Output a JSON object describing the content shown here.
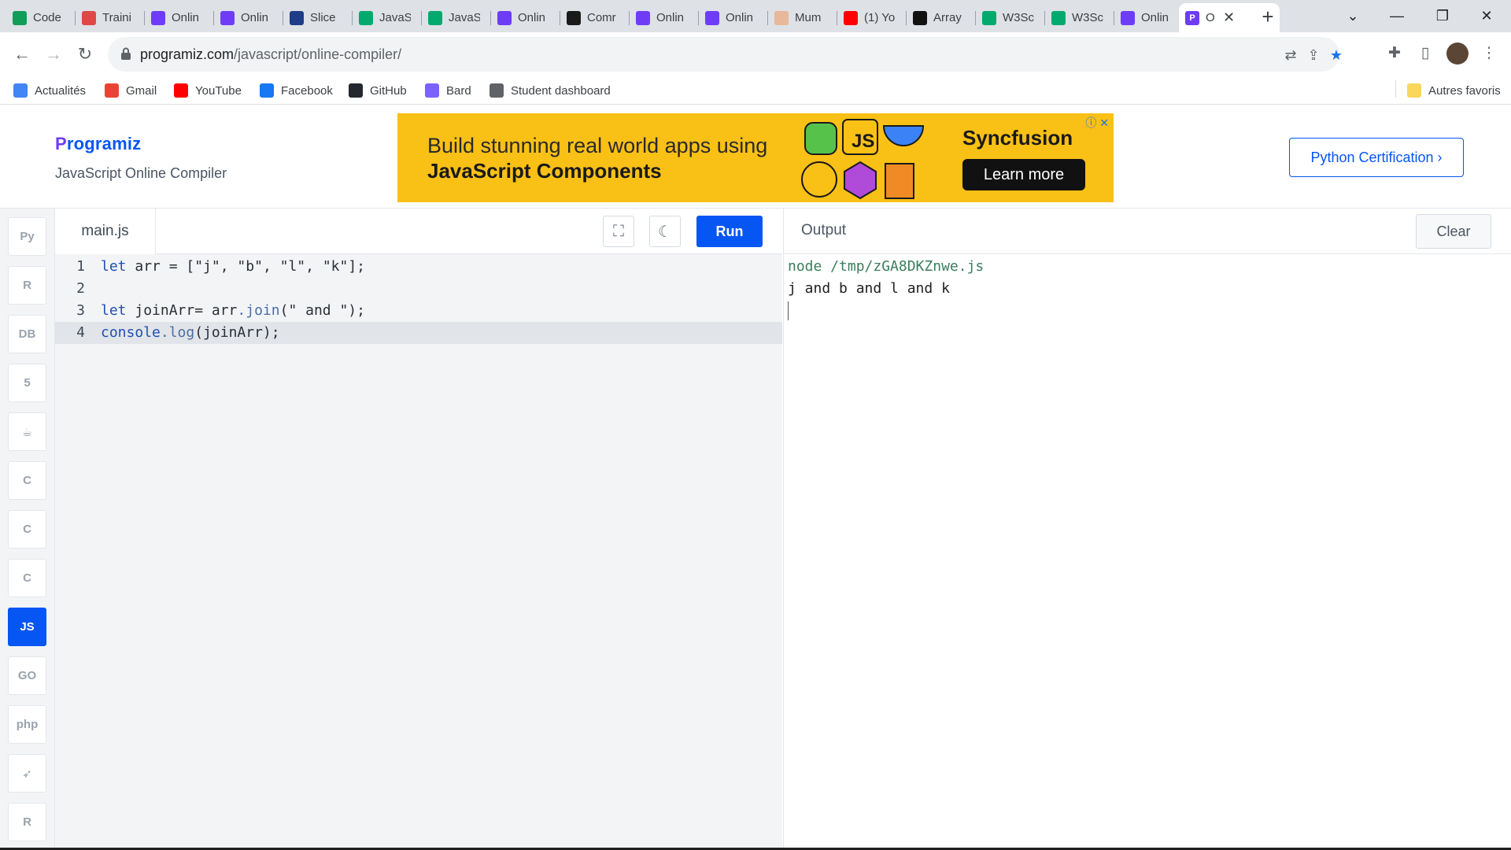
{
  "browser": {
    "tabs": [
      {
        "title": "Code",
        "icon": "sheets-icon",
        "color": "#0f9d58"
      },
      {
        "title": "Traini",
        "icon": "openai-icon",
        "color": "#e04848"
      },
      {
        "title": "Onlin",
        "icon": "programiz-icon",
        "color": "#6e3cf7"
      },
      {
        "title": "Onlin",
        "icon": "programiz-icon",
        "color": "#6e3cf7"
      },
      {
        "title": "Slice",
        "icon": "slice-icon",
        "color": "#1f3c88"
      },
      {
        "title": "JavaS",
        "icon": "w3schools-icon",
        "color": "#04aa6d"
      },
      {
        "title": "JavaS",
        "icon": "w3schools-icon",
        "color": "#04aa6d"
      },
      {
        "title": "Onlin",
        "icon": "programiz-icon",
        "color": "#6e3cf7"
      },
      {
        "title": "Comr",
        "icon": "timer-icon",
        "color": "#1a1a1a"
      },
      {
        "title": "Onlin",
        "icon": "programiz-icon",
        "color": "#6e3cf7"
      },
      {
        "title": "Onlin",
        "icon": "programiz-icon",
        "color": "#6e3cf7"
      },
      {
        "title": "Mum",
        "icon": "mumbai-icon",
        "color": "#e8b89a"
      },
      {
        "title": "(1) Yo",
        "icon": "youtube-icon",
        "color": "#ff0000"
      },
      {
        "title": "Array",
        "icon": "mdn-icon",
        "color": "#111111"
      },
      {
        "title": "W3Sc",
        "icon": "w3schools-icon",
        "color": "#04aa6d"
      },
      {
        "title": "W3Sc",
        "icon": "w3schools-icon",
        "color": "#04aa6d"
      },
      {
        "title": "Onlin",
        "icon": "programiz-icon",
        "color": "#6e3cf7"
      }
    ],
    "active_tab": {
      "title": "O",
      "icon": "programiz-icon",
      "color": "#6e3cf7"
    },
    "new_tab": "+",
    "window": {
      "tab_search": "⌄",
      "minimize": "—",
      "restore": "❐",
      "close": "✕"
    },
    "nav": {
      "back": "←",
      "forward": "→",
      "reload": "↻"
    },
    "url": {
      "host": "programiz.com",
      "path": "/javascript/online-compiler/"
    },
    "omnibox_icons": {
      "translate": "⇄",
      "share": "⇪",
      "bookmark": "★"
    },
    "toolbar_icons": {
      "extensions": "✚",
      "sidepanel": "▯",
      "menu": "⋮"
    },
    "bookmarks": [
      {
        "label": "Actualités",
        "icon": "news-icon",
        "color": "#4285f4"
      },
      {
        "label": "Gmail",
        "icon": "gmail-icon",
        "color": "#ea4335"
      },
      {
        "label": "YouTube",
        "icon": "youtube-icon",
        "color": "#ff0000"
      },
      {
        "label": "Facebook",
        "icon": "facebook-icon",
        "color": "#1877f2"
      },
      {
        "label": "GitHub",
        "icon": "github-icon",
        "color": "#24292f"
      },
      {
        "label": "Bard",
        "icon": "bard-icon",
        "color": "#7b61ff"
      },
      {
        "label": "Student dashboard",
        "icon": "globe-icon",
        "color": "#5f6368"
      }
    ],
    "other_bookmarks": "Autres favoris"
  },
  "header": {
    "logo_first": "P",
    "logo_rest": "rogramiz",
    "subtitle": "JavaScript Online Compiler",
    "ad": {
      "line1": "Build stunning real world apps using",
      "line2": "JavaScript Components",
      "brand": "Syncfusion",
      "cta": "Learn more",
      "js_badge": "JS",
      "close": "ⓘ ✕"
    },
    "cert_button": "Python Certification ›"
  },
  "rail": {
    "languages": [
      {
        "name": "python",
        "glyph": "Py",
        "active": false
      },
      {
        "name": "r",
        "glyph": "R",
        "active": false
      },
      {
        "name": "sql",
        "glyph": "DB",
        "active": false
      },
      {
        "name": "html",
        "glyph": "5",
        "active": false
      },
      {
        "name": "java",
        "glyph": "☕",
        "active": false
      },
      {
        "name": "c",
        "glyph": "C",
        "active": false
      },
      {
        "name": "cpp",
        "glyph": "C",
        "active": false
      },
      {
        "name": "csharp",
        "glyph": "C",
        "active": false
      },
      {
        "name": "javascript",
        "glyph": "JS",
        "active": true
      },
      {
        "name": "go",
        "glyph": "GO",
        "active": false
      },
      {
        "name": "php",
        "glyph": "php",
        "active": false
      },
      {
        "name": "swift",
        "glyph": "➶",
        "active": false
      },
      {
        "name": "rust",
        "glyph": "R",
        "active": false
      }
    ]
  },
  "editor": {
    "file_name": "main.js",
    "fullscreen": "⛶",
    "theme": "☾",
    "run": "Run",
    "lines": [
      {
        "num": "1",
        "code": "let arr = [\"j\", \"b\", \"l\", \"k\"];"
      },
      {
        "num": "2",
        "code": ""
      },
      {
        "num": "3",
        "code": "let joinArr= arr.join(\" and \");"
      },
      {
        "num": "4",
        "code": "console.log(joinArr);"
      }
    ],
    "current_line": 4
  },
  "output": {
    "title": "Output",
    "clear": "Clear",
    "command": "node /tmp/zGA8DKZnwe.js",
    "result": "j and b and l and k"
  }
}
